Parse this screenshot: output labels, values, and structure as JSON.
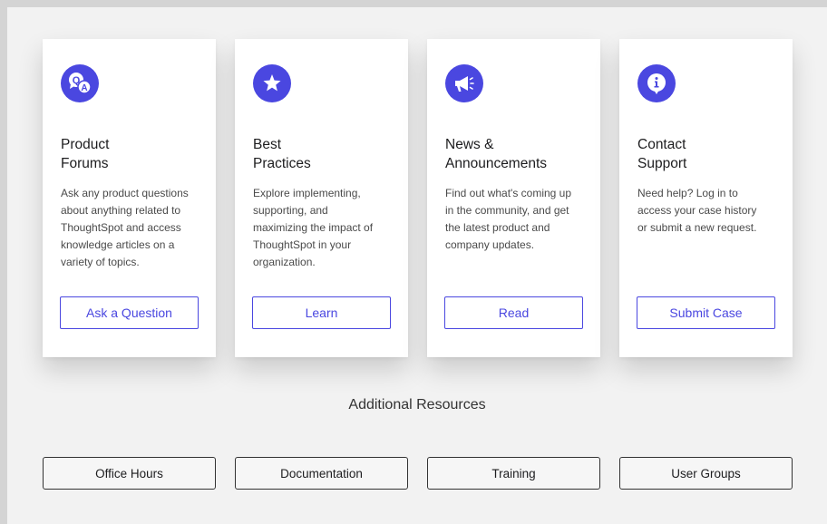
{
  "colors": {
    "accent": "#4a47e0",
    "card_bg": "#ffffff",
    "page_bg": "#f2f2f2"
  },
  "cards": [
    {
      "icon": "qa-bubbles-icon",
      "title_lines": [
        "Product",
        "Forums"
      ],
      "desc_lines": [
        "Ask any product questions",
        "about anything related to",
        "ThoughtSpot and access",
        "knowledge articles on a",
        "variety of topics."
      ],
      "cta": "Ask a Question"
    },
    {
      "icon": "star-icon",
      "title_lines": [
        "Best",
        "Practices"
      ],
      "desc_lines": [
        "Explore implementing,",
        "supporting, and",
        "maximizing the impact of",
        "ThoughtSpot in your",
        "organization."
      ],
      "cta": "Learn"
    },
    {
      "icon": "megaphone-icon",
      "title_lines": [
        "News &",
        "Announcements"
      ],
      "desc_lines": [
        "Find out what's coming up",
        "in the community, and get",
        "the latest product and",
        "company updates."
      ],
      "cta": "Read"
    },
    {
      "icon": "info-icon",
      "title_lines": [
        "Contact",
        "Support"
      ],
      "desc_lines": [
        "Need help? Log in to",
        "access your case history",
        "or submit a new request."
      ],
      "cta": "Submit Case"
    }
  ],
  "resources": {
    "title": "Additional Resources",
    "links": [
      "Office Hours",
      "Documentation",
      "Training",
      "User Groups"
    ]
  }
}
